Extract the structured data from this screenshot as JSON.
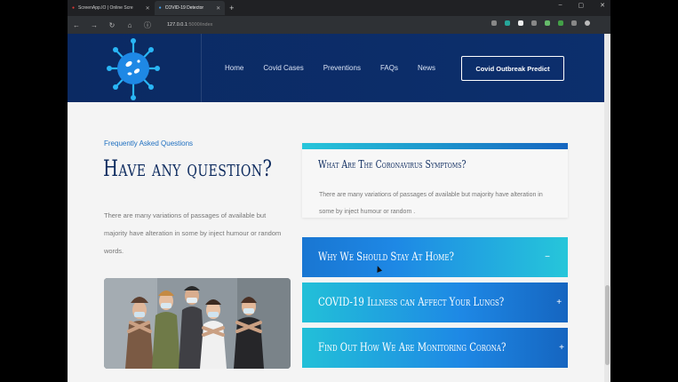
{
  "browser": {
    "tabs": [
      {
        "label": "ScreenApp.IO | Online Scre",
        "active": false
      },
      {
        "label": "COVID-19 Detector",
        "active": true
      }
    ],
    "new_tab": "+",
    "url_host": "127.0.0.1",
    "url_path": ":5000/index"
  },
  "header": {
    "menu": [
      "Home",
      "Covid Cases",
      "Preventions",
      "FAQs",
      "News"
    ],
    "cta_label": "Covid Outbreak Predict",
    "brand_color": "#0b2a63"
  },
  "faq_section": {
    "eyebrow": "Frequently Asked Questions",
    "title": "Have any question?",
    "description": "There are many variations of passages of available but majority have alteration in some by inject humour or random words.",
    "items": [
      {
        "question": "What Are The Coronavirus Symptoms?",
        "answer": "There are many variations of passages of available but majority have alteration in some by inject humour or random .",
        "expanded": true
      },
      {
        "question": "Why We Should Stay At Home?",
        "toggle": "−",
        "expanded": false
      },
      {
        "question": "COVID-19 Illness can Affect Your Lungs?",
        "toggle": "+",
        "expanded": false
      },
      {
        "question": "Find Out How We Are Monitoring Corona?",
        "toggle": "+",
        "expanded": false
      }
    ]
  },
  "icons": [
    "virus-logo-icon",
    "back-arrow-icon",
    "forward-arrow-icon",
    "reload-icon",
    "home-icon",
    "info-icon",
    "mask-people-photo"
  ]
}
